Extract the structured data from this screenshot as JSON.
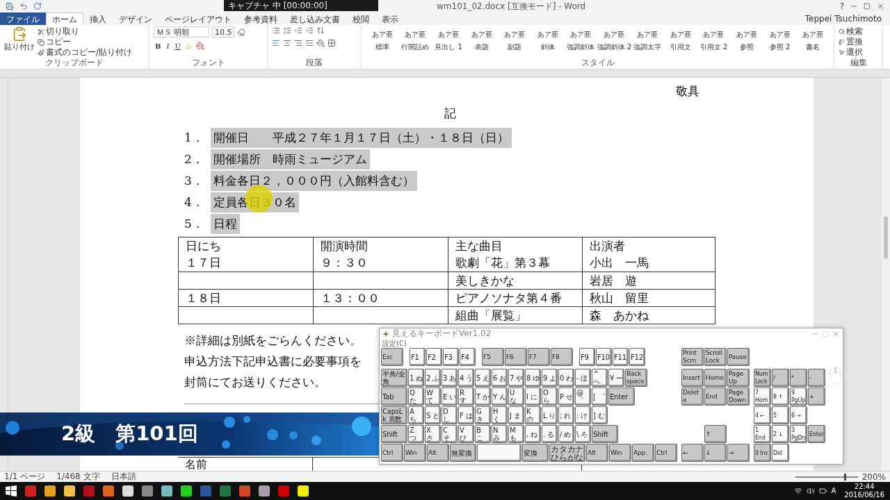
{
  "title_bar": {
    "title": "wm101_02.docx [互換モード] - Word",
    "recorder": "キャプチャ 中 [00:00:00]",
    "help": "?",
    "user": "Teppei Tsuchimoto"
  },
  "ribbon_tabs": [
    {
      "label": "ファイル",
      "kind": "file",
      "selected": false
    },
    {
      "label": "ホーム",
      "kind": "tab",
      "selected": true
    },
    {
      "label": "挿入",
      "kind": "tab",
      "selected": false
    },
    {
      "label": "デザイン",
      "kind": "tab",
      "selected": false
    },
    {
      "label": "ページレイアウト",
      "kind": "tab",
      "selected": false
    },
    {
      "label": "参考資料",
      "kind": "tab",
      "selected": false
    },
    {
      "label": "差し込み文書",
      "kind": "tab",
      "selected": false
    },
    {
      "label": "校閲",
      "kind": "tab",
      "selected": false
    },
    {
      "label": "表示",
      "kind": "tab",
      "selected": false
    }
  ],
  "clipboard": {
    "paste": "貼り付け",
    "cut": "切り取り",
    "copy": "コピー",
    "painter": "書式のコピー/貼り付け",
    "label": "クリップボード"
  },
  "font": {
    "name": "ＭＳ 明朝",
    "size": "10.5",
    "bold": "B",
    "italic": "I",
    "underline": "U",
    "label": "フォント"
  },
  "paragraph": {
    "label": "段落"
  },
  "styles": {
    "label": "スタイル",
    "items": [
      {
        "preview": "あア亜",
        "name": "標準"
      },
      {
        "preview": "あア亜",
        "name": "行間詰め"
      },
      {
        "preview": "あア亜",
        "name": "見出し 1"
      },
      {
        "preview": "あア亜",
        "name": "表題"
      },
      {
        "preview": "あア亜",
        "name": "副題"
      },
      {
        "preview": "あア亜",
        "name": "斜体"
      },
      {
        "preview": "あア亜",
        "name": "強調斜体"
      },
      {
        "preview": "あア亜",
        "name": "強調斜体 2"
      },
      {
        "preview": "あア亜",
        "name": "強調太字"
      },
      {
        "preview": "あア亜",
        "name": "引用文"
      },
      {
        "preview": "あア亜",
        "name": "引用文 2"
      },
      {
        "preview": "あア亜",
        "name": "参照"
      },
      {
        "preview": "あア亜",
        "name": "参照 2"
      },
      {
        "preview": "あア亜",
        "name": "書名"
      }
    ]
  },
  "editing": {
    "label": "編集",
    "items": [
      "検索",
      "置換",
      "選択"
    ]
  },
  "document": {
    "closing": "敬具",
    "heading": "記",
    "list": [
      {
        "number": "1．",
        "text": "開催日　　平成２７年１月１７日（土）・１８日（日）",
        "selected": true
      },
      {
        "number": "2．",
        "text": "開催場所　時雨ミュージアム",
        "selected": true
      },
      {
        "number": "3．",
        "text": "料金各日２，０００円（入館料含む）",
        "selected": true
      },
      {
        "number": "4．",
        "text": "定員各日３０名",
        "selected": true
      },
      {
        "number": "5．",
        "text": "日程",
        "selected": true
      }
    ],
    "table": {
      "columns": [
        "日にち",
        "開演時間",
        "主な曲目",
        "出演者"
      ],
      "rows": [
        [
          "１７日",
          "９：３０",
          "歌劇「花」第３幕",
          "小出　一馬"
        ],
        [
          "",
          "",
          "美しきかな",
          "岩居　遊"
        ],
        [
          "１８日",
          "１３：００",
          "ピアノソナタ第４番",
          "秋山　留里"
        ],
        [
          "",
          "",
          "組曲「展覧」",
          "森　あかね"
        ]
      ]
    },
    "paragraphs": [
      "※詳細は別紙をごらんください。",
      "申込方法下記申込書に必要事項を",
      "封筒にてお送りください。"
    ],
    "form_table": {
      "label": "名前"
    }
  },
  "status_bar": {
    "page": "1/1 ページ",
    "words": "1/468 文字",
    "language": "日本語",
    "zoom": "200%",
    "zoom_slider": {
      "level": 0.78
    }
  },
  "taskbar": {
    "ime": "A",
    "time": "22:44",
    "date": "2016/06/16"
  },
  "banner": {
    "text": "2級　第101回"
  },
  "keyboard_window": {
    "title": "見えるキーボードVer1.02",
    "menu": "設定(C)",
    "function_groups": [
      [
        {
          "label": "Esc",
          "kind": "mod"
        }
      ],
      [
        {
          "label": "F1",
          "kind": "key"
        },
        {
          "label": "F2",
          "kind": "key"
        },
        {
          "label": "F3",
          "kind": "key"
        },
        {
          "label": "F4",
          "kind": "key"
        }
      ],
      [
        {
          "label": "F5",
          "kind": "mod"
        },
        {
          "label": "F6",
          "kind": "mod"
        },
        {
          "label": "F7",
          "kind": "mod"
        },
        {
          "label": "F8",
          "kind": "mod"
        }
      ],
      [
        {
          "label": "F9",
          "kind": "key"
        },
        {
          "label": "F10",
          "kind": "key"
        },
        {
          "label": "F11",
          "kind": "key"
        },
        {
          "label": "F12",
          "kind": "key"
        }
      ]
    ],
    "main_rows": [
      [
        {
          "label": "半角/全角",
          "kind": "wide"
        },
        {
          "label": "1 ぬ",
          "kind": "key"
        },
        {
          "label": "2 ふ",
          "kind": "key"
        },
        {
          "label": "3 あ",
          "kind": "key"
        },
        {
          "label": "4 う",
          "kind": "key"
        },
        {
          "label": "5 え",
          "kind": "key"
        },
        {
          "label": "6 お",
          "kind": "key"
        },
        {
          "label": "7 や",
          "kind": "key"
        },
        {
          "label": "8 ゆ",
          "kind": "key"
        },
        {
          "label": "9 よ",
          "kind": "key"
        },
        {
          "label": "0 わ",
          "kind": "key"
        },
        {
          "label": "- ほ",
          "kind": "key"
        },
        {
          "label": "^ へ",
          "kind": "key"
        },
        {
          "label": "¥ ー",
          "kind": "key"
        },
        {
          "label": "Back space",
          "kind": "mod"
        }
      ],
      [
        {
          "label": "Tab",
          "kind": "wide"
        },
        {
          "label": "Q た",
          "kind": "key"
        },
        {
          "label": "W て",
          "kind": "key"
        },
        {
          "label": "E い",
          "kind": "key"
        },
        {
          "label": "R す",
          "kind": "key"
        },
        {
          "label": "T か",
          "kind": "key"
        },
        {
          "label": "Y ん",
          "kind": "key"
        },
        {
          "label": "U な",
          "kind": "key"
        },
        {
          "label": "I に",
          "kind": "key"
        },
        {
          "label": "O ら",
          "kind": "key"
        },
        {
          "label": "P せ",
          "kind": "key"
        },
        {
          "label": "@ ゛",
          "kind": "key"
        },
        {
          "label": "[ ゜",
          "kind": "key"
        },
        {
          "label": "Enter",
          "kind": "wide"
        }
      ],
      [
        {
          "label": "CapsLk 英数",
          "kind": "wide"
        },
        {
          "label": "A ち",
          "kind": "key"
        },
        {
          "label": "S と",
          "kind": "key"
        },
        {
          "label": "D し",
          "kind": "key"
        },
        {
          "label": "F は",
          "kind": "key"
        },
        {
          "label": "G き",
          "kind": "key"
        },
        {
          "label": "H く",
          "kind": "key"
        },
        {
          "label": "J ま",
          "kind": "key"
        },
        {
          "label": "K の",
          "kind": "key"
        },
        {
          "label": "L り",
          "kind": "key"
        },
        {
          "label": "; れ",
          "kind": "key"
        },
        {
          "label": ": け",
          "kind": "key"
        },
        {
          "label": "] む",
          "kind": "key"
        }
      ],
      [
        {
          "label": "Shift",
          "kind": "wide"
        },
        {
          "label": "Z つ",
          "kind": "key"
        },
        {
          "label": "X さ",
          "kind": "key"
        },
        {
          "label": "C そ",
          "kind": "key"
        },
        {
          "label": "V ひ",
          "kind": "key"
        },
        {
          "label": "B こ",
          "kind": "key"
        },
        {
          "label": "N み",
          "kind": "key"
        },
        {
          "label": "M も",
          "kind": "key"
        },
        {
          "label": ", ね",
          "kind": "key"
        },
        {
          "label": ". る",
          "kind": "key"
        },
        {
          "label": "/ め",
          "kind": "key"
        },
        {
          "label": "\\ ろ",
          "kind": "key"
        },
        {
          "label": "Shift",
          "kind": "wide"
        }
      ],
      [
        {
          "label": "Ctrl",
          "kind": "mod"
        },
        {
          "label": "Win",
          "kind": "mod"
        },
        {
          "label": "Alt",
          "kind": "mod"
        },
        {
          "label": "無変換",
          "kind": "wide"
        },
        {
          "kind": "space"
        },
        {
          "label": "変換",
          "kind": "wide"
        },
        {
          "label": "カタカナひらがな",
          "kind": "long"
        },
        {
          "label": "Alt",
          "kind": "mod"
        },
        {
          "label": "Win",
          "kind": "mod"
        },
        {
          "label": "App.",
          "kind": "mod"
        },
        {
          "label": "Ctrl",
          "kind": "mod"
        }
      ]
    ],
    "nav_rows": [
      [
        {
          "label": "Print Scrn",
          "kind": "mod"
        },
        {
          "label": "Scroll Lock",
          "kind": "mod"
        },
        {
          "label": "Pause",
          "kind": "mod"
        }
      ],
      [
        {
          "label": "Insert",
          "kind": "mod"
        },
        {
          "label": "Home",
          "kind": "mod"
        },
        {
          "label": "Page Up",
          "kind": "mod"
        }
      ],
      [
        {
          "label": "Delete",
          "kind": "mod"
        },
        {
          "label": "End",
          "kind": "mod"
        },
        {
          "label": "Page Down",
          "kind": "mod"
        }
      ],
      [],
      [
        {
          "label": "↑",
          "kind": "mod"
        }
      ],
      [
        {
          "label": "←",
          "kind": "mod"
        },
        {
          "label": "↓",
          "kind": "mod"
        },
        {
          "label": "→",
          "kind": "mod"
        }
      ]
    ],
    "numpad_rows": [
      [
        {
          "label": "Num Lock",
          "kind": "mod"
        },
        {
          "label": "/",
          "kind": "mod"
        },
        {
          "label": "*",
          "kind": "mod"
        },
        {
          "label": "-",
          "kind": "mod"
        }
      ],
      [
        {
          "label": "7 Home",
          "kind": "key"
        },
        {
          "label": "8 ↑",
          "kind": "key"
        },
        {
          "label": "9 PgUp",
          "kind": "key"
        },
        {
          "label": "+",
          "kind": "mod"
        }
      ],
      [
        {
          "label": "4 ←",
          "kind": "key"
        },
        {
          "label": "5",
          "kind": "key"
        },
        {
          "label": "6 →",
          "kind": "key"
        }
      ],
      [
        {
          "label": "1 End",
          "kind": "key"
        },
        {
          "label": "2 ↓",
          "kind": "key"
        },
        {
          "label": "3 PgDn",
          "kind": "key"
        },
        {
          "label": "Enter",
          "kind": "mod"
        }
      ],
      [
        {
          "label": "0 Ins",
          "kind": "wide"
        },
        {
          "label": "Del",
          "kind": "key"
        }
      ]
    ]
  }
}
